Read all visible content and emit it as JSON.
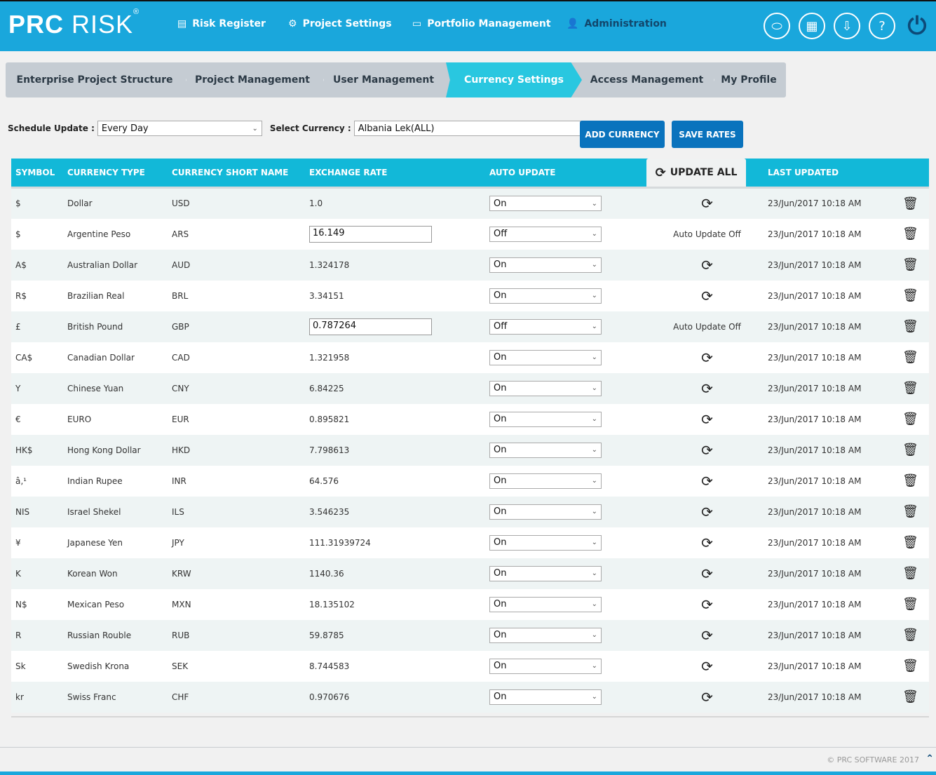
{
  "app": {
    "logo": "PRC RISK",
    "registered": "®"
  },
  "nav": [
    {
      "label": "Risk Register",
      "icon": "document-icon"
    },
    {
      "label": "Project Settings",
      "icon": "settings-icon"
    },
    {
      "label": "Portfolio Management",
      "icon": "folder-icon"
    },
    {
      "label": "Administration",
      "icon": "user-icon"
    }
  ],
  "header_icons": [
    "toggle-icon",
    "calendar-download-icon",
    "inbox-download-icon",
    "help-icon",
    "power-icon"
  ],
  "breadcrumbs": [
    {
      "label": "Enterprise Project Structure"
    },
    {
      "label": "Project Management"
    },
    {
      "label": "User Management"
    },
    {
      "label": "Currency Settings",
      "active": true
    },
    {
      "label": "Access Management"
    },
    {
      "label": "My Profile"
    }
  ],
  "controls": {
    "schedule_label": "Schedule Update :",
    "schedule_value": "Every Day",
    "currency_label": "Select Currency :",
    "currency_value": "Albania Lek(ALL)",
    "add_currency": "ADD CURRENCY",
    "save_rates": "SAVE RATES"
  },
  "table": {
    "columns": [
      "SYMBOL",
      "CURRENCY TYPE",
      "CURRENCY SHORT NAME",
      "EXCHANGE RATE",
      "AUTO UPDATE",
      "UPDATE ALL",
      "LAST UPDATED"
    ],
    "auto_off_text": "Auto Update Off",
    "rows": [
      {
        "symbol": "$",
        "type": "Dollar",
        "short": "USD",
        "rate": "1.0",
        "editable": false,
        "auto": "On",
        "updated": "23/Jun/2017 10:18 AM"
      },
      {
        "symbol": "$",
        "type": "Argentine Peso",
        "short": "ARS",
        "rate": "16.149",
        "editable": true,
        "auto": "Off",
        "updated": "23/Jun/2017 10:18 AM"
      },
      {
        "symbol": "A$",
        "type": "Australian Dollar",
        "short": "AUD",
        "rate": "1.324178",
        "editable": false,
        "auto": "On",
        "updated": "23/Jun/2017 10:18 AM"
      },
      {
        "symbol": "R$",
        "type": "Brazilian Real",
        "short": "BRL",
        "rate": "3.34151",
        "editable": false,
        "auto": "On",
        "updated": "23/Jun/2017 10:18 AM"
      },
      {
        "symbol": "£",
        "type": "British Pound",
        "short": "GBP",
        "rate": "0.787264",
        "editable": true,
        "auto": "Off",
        "updated": "23/Jun/2017 10:18 AM"
      },
      {
        "symbol": "CA$",
        "type": "Canadian Dollar",
        "short": "CAD",
        "rate": "1.321958",
        "editable": false,
        "auto": "On",
        "updated": "23/Jun/2017 10:18 AM"
      },
      {
        "symbol": "Y",
        "type": "Chinese Yuan",
        "short": "CNY",
        "rate": "6.84225",
        "editable": false,
        "auto": "On",
        "updated": "23/Jun/2017 10:18 AM"
      },
      {
        "symbol": "€",
        "type": "EURO",
        "short": "EUR",
        "rate": "0.895821",
        "editable": false,
        "auto": "On",
        "updated": "23/Jun/2017 10:18 AM"
      },
      {
        "symbol": "HK$",
        "type": "Hong Kong Dollar",
        "short": "HKD",
        "rate": "7.798613",
        "editable": false,
        "auto": "On",
        "updated": "23/Jun/2017 10:18 AM"
      },
      {
        "symbol": "â‚¹",
        "type": "Indian Rupee",
        "short": "INR",
        "rate": "64.576",
        "editable": false,
        "auto": "On",
        "updated": "23/Jun/2017 10:18 AM"
      },
      {
        "symbol": "NIS",
        "type": "Israel Shekel",
        "short": "ILS",
        "rate": "3.546235",
        "editable": false,
        "auto": "On",
        "updated": "23/Jun/2017 10:18 AM"
      },
      {
        "symbol": "¥",
        "type": "Japanese Yen",
        "short": "JPY",
        "rate": "111.31939724",
        "editable": false,
        "auto": "On",
        "updated": "23/Jun/2017 10:18 AM"
      },
      {
        "symbol": "K",
        "type": "Korean Won",
        "short": "KRW",
        "rate": "1140.36",
        "editable": false,
        "auto": "On",
        "updated": "23/Jun/2017 10:18 AM"
      },
      {
        "symbol": "N$",
        "type": "Mexican Peso",
        "short": "MXN",
        "rate": "18.135102",
        "editable": false,
        "auto": "On",
        "updated": "23/Jun/2017 10:18 AM"
      },
      {
        "symbol": "R",
        "type": "Russian Rouble",
        "short": "RUB",
        "rate": "59.8785",
        "editable": false,
        "auto": "On",
        "updated": "23/Jun/2017 10:18 AM"
      },
      {
        "symbol": "Sk",
        "type": "Swedish Krona",
        "short": "SEK",
        "rate": "8.744583",
        "editable": false,
        "auto": "On",
        "updated": "23/Jun/2017 10:18 AM"
      },
      {
        "symbol": "kr",
        "type": "Swiss Franc",
        "short": "CHF",
        "rate": "0.970676",
        "editable": false,
        "auto": "On",
        "updated": "23/Jun/2017 10:18 AM"
      }
    ]
  },
  "footer": {
    "copyright": "© PRC SOFTWARE 2017"
  },
  "colors": {
    "header": "#1aa7dc",
    "table_header": "#12b8d8",
    "active_tab": "#29c7e0",
    "button": "#0a73bd"
  }
}
